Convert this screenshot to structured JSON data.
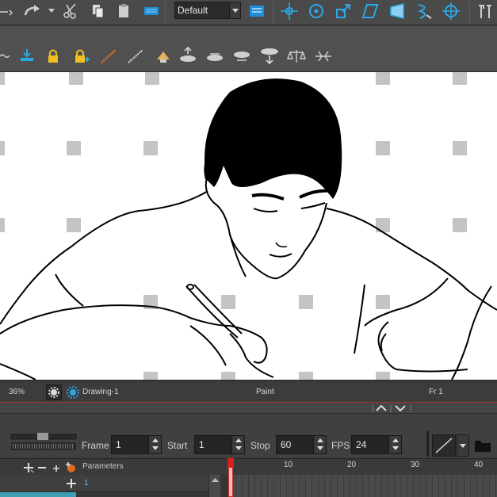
{
  "toolbar": {
    "preset_dropdown": "Default",
    "icons_row1": [
      "line-icon",
      "redo-icon",
      "dropdown-arrow-icon",
      "cut-icon",
      "copy-icon",
      "paste-icon",
      "blue-brush-icon",
      "layer-options-icon",
      "pivot-icon",
      "rotate-icon",
      "scale-icon",
      "skew-icon",
      "perspective-icon",
      "envelope-icon",
      "transform-icon",
      "hammer-icon"
    ],
    "icons_row2": [
      "tilde-icon",
      "flatten-icon",
      "lock-icon",
      "lock-add-icon",
      "ruler-icon",
      "grid-icon",
      "cursor-icon",
      "layer-up-icon",
      "layer-center-icon",
      "layer-down-icon",
      "layer-bottom-icon",
      "balance-icon",
      "distribute-icon"
    ]
  },
  "status": {
    "zoom": "36%",
    "drawing": "Drawing-1",
    "mode": "Paint",
    "frame": "Fr 1"
  },
  "timeline": {
    "frame_label": "Frame",
    "frame_value": "1",
    "start_label": "Start",
    "start_value": "1",
    "stop_label": "Stop",
    "stop_value": "60",
    "fps_label": "FPS",
    "fps_value": "24",
    "params_label": "Parameters",
    "layer_number": "1",
    "ruler_marks": [
      "10",
      "20",
      "30",
      "40"
    ]
  },
  "colors": {
    "accent_blue": "#1e8fd6",
    "playhead": "#d42020",
    "layer_teal": "#3ea0b4"
  }
}
